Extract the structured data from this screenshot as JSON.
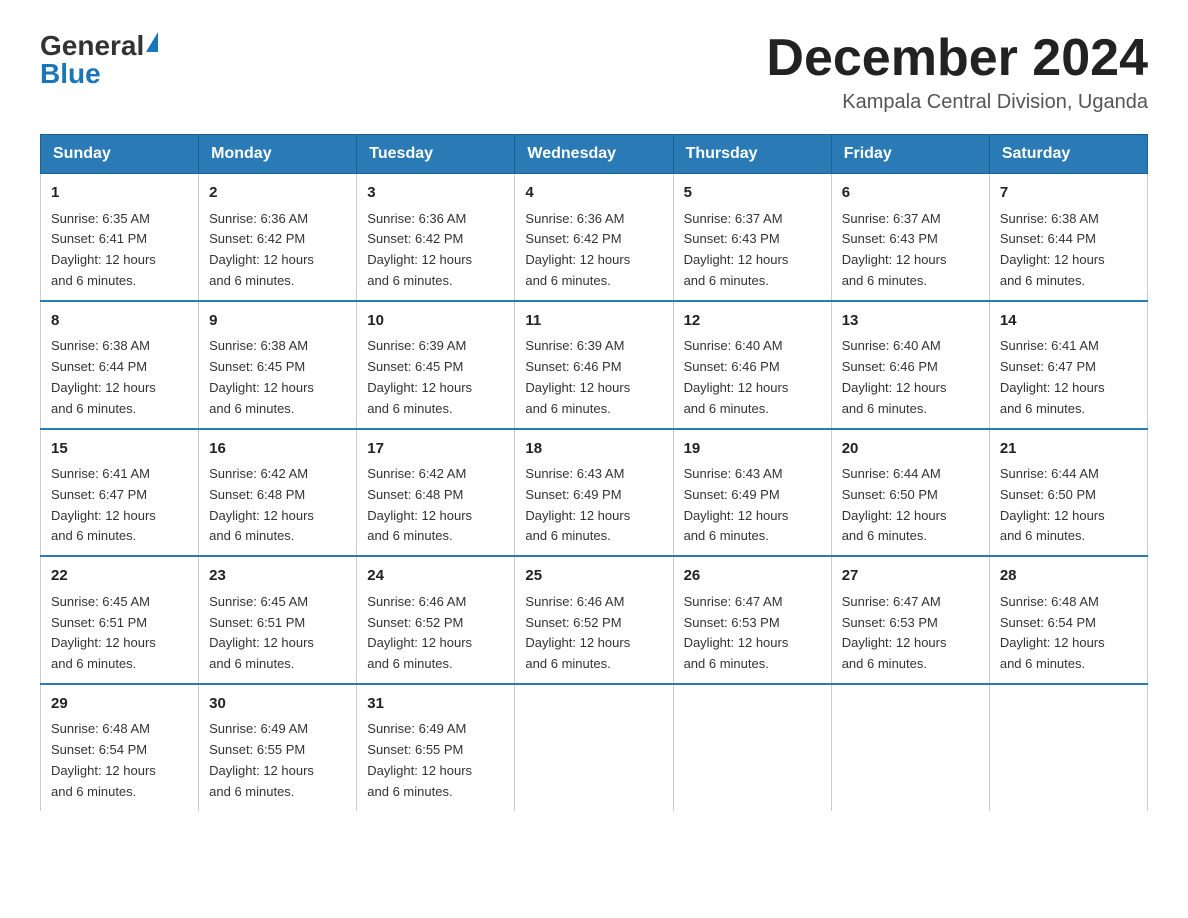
{
  "header": {
    "logo_general": "General",
    "logo_blue": "Blue",
    "month_title": "December 2024",
    "location": "Kampala Central Division, Uganda"
  },
  "days_of_week": [
    "Sunday",
    "Monday",
    "Tuesday",
    "Wednesday",
    "Thursday",
    "Friday",
    "Saturday"
  ],
  "weeks": [
    [
      {
        "day": "1",
        "sunrise": "6:35 AM",
        "sunset": "6:41 PM",
        "daylight": "12 hours and 6 minutes."
      },
      {
        "day": "2",
        "sunrise": "6:36 AM",
        "sunset": "6:42 PM",
        "daylight": "12 hours and 6 minutes."
      },
      {
        "day": "3",
        "sunrise": "6:36 AM",
        "sunset": "6:42 PM",
        "daylight": "12 hours and 6 minutes."
      },
      {
        "day": "4",
        "sunrise": "6:36 AM",
        "sunset": "6:42 PM",
        "daylight": "12 hours and 6 minutes."
      },
      {
        "day": "5",
        "sunrise": "6:37 AM",
        "sunset": "6:43 PM",
        "daylight": "12 hours and 6 minutes."
      },
      {
        "day": "6",
        "sunrise": "6:37 AM",
        "sunset": "6:43 PM",
        "daylight": "12 hours and 6 minutes."
      },
      {
        "day": "7",
        "sunrise": "6:38 AM",
        "sunset": "6:44 PM",
        "daylight": "12 hours and 6 minutes."
      }
    ],
    [
      {
        "day": "8",
        "sunrise": "6:38 AM",
        "sunset": "6:44 PM",
        "daylight": "12 hours and 6 minutes."
      },
      {
        "day": "9",
        "sunrise": "6:38 AM",
        "sunset": "6:45 PM",
        "daylight": "12 hours and 6 minutes."
      },
      {
        "day": "10",
        "sunrise": "6:39 AM",
        "sunset": "6:45 PM",
        "daylight": "12 hours and 6 minutes."
      },
      {
        "day": "11",
        "sunrise": "6:39 AM",
        "sunset": "6:46 PM",
        "daylight": "12 hours and 6 minutes."
      },
      {
        "day": "12",
        "sunrise": "6:40 AM",
        "sunset": "6:46 PM",
        "daylight": "12 hours and 6 minutes."
      },
      {
        "day": "13",
        "sunrise": "6:40 AM",
        "sunset": "6:46 PM",
        "daylight": "12 hours and 6 minutes."
      },
      {
        "day": "14",
        "sunrise": "6:41 AM",
        "sunset": "6:47 PM",
        "daylight": "12 hours and 6 minutes."
      }
    ],
    [
      {
        "day": "15",
        "sunrise": "6:41 AM",
        "sunset": "6:47 PM",
        "daylight": "12 hours and 6 minutes."
      },
      {
        "day": "16",
        "sunrise": "6:42 AM",
        "sunset": "6:48 PM",
        "daylight": "12 hours and 6 minutes."
      },
      {
        "day": "17",
        "sunrise": "6:42 AM",
        "sunset": "6:48 PM",
        "daylight": "12 hours and 6 minutes."
      },
      {
        "day": "18",
        "sunrise": "6:43 AM",
        "sunset": "6:49 PM",
        "daylight": "12 hours and 6 minutes."
      },
      {
        "day": "19",
        "sunrise": "6:43 AM",
        "sunset": "6:49 PM",
        "daylight": "12 hours and 6 minutes."
      },
      {
        "day": "20",
        "sunrise": "6:44 AM",
        "sunset": "6:50 PM",
        "daylight": "12 hours and 6 minutes."
      },
      {
        "day": "21",
        "sunrise": "6:44 AM",
        "sunset": "6:50 PM",
        "daylight": "12 hours and 6 minutes."
      }
    ],
    [
      {
        "day": "22",
        "sunrise": "6:45 AM",
        "sunset": "6:51 PM",
        "daylight": "12 hours and 6 minutes."
      },
      {
        "day": "23",
        "sunrise": "6:45 AM",
        "sunset": "6:51 PM",
        "daylight": "12 hours and 6 minutes."
      },
      {
        "day": "24",
        "sunrise": "6:46 AM",
        "sunset": "6:52 PM",
        "daylight": "12 hours and 6 minutes."
      },
      {
        "day": "25",
        "sunrise": "6:46 AM",
        "sunset": "6:52 PM",
        "daylight": "12 hours and 6 minutes."
      },
      {
        "day": "26",
        "sunrise": "6:47 AM",
        "sunset": "6:53 PM",
        "daylight": "12 hours and 6 minutes."
      },
      {
        "day": "27",
        "sunrise": "6:47 AM",
        "sunset": "6:53 PM",
        "daylight": "12 hours and 6 minutes."
      },
      {
        "day": "28",
        "sunrise": "6:48 AM",
        "sunset": "6:54 PM",
        "daylight": "12 hours and 6 minutes."
      }
    ],
    [
      {
        "day": "29",
        "sunrise": "6:48 AM",
        "sunset": "6:54 PM",
        "daylight": "12 hours and 6 minutes."
      },
      {
        "day": "30",
        "sunrise": "6:49 AM",
        "sunset": "6:55 PM",
        "daylight": "12 hours and 6 minutes."
      },
      {
        "day": "31",
        "sunrise": "6:49 AM",
        "sunset": "6:55 PM",
        "daylight": "12 hours and 6 minutes."
      },
      null,
      null,
      null,
      null
    ]
  ],
  "labels": {
    "sunrise": "Sunrise:",
    "sunset": "Sunset:",
    "daylight": "Daylight:"
  }
}
